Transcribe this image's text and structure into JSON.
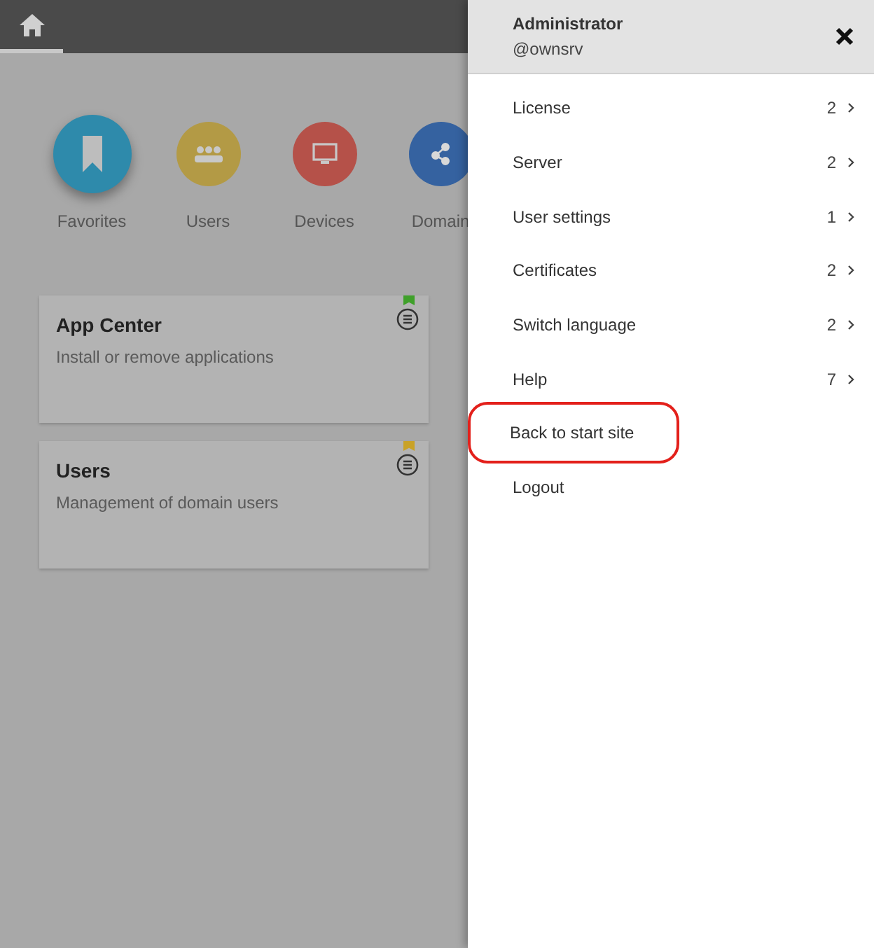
{
  "top_bar": {
    "home_tab": {
      "selected": true
    }
  },
  "categories": [
    {
      "label": "Favorites",
      "color": "#2e8aab",
      "kind": "bookmark",
      "selected": true
    },
    {
      "label": "Users",
      "color": "#b39a45",
      "kind": "users",
      "selected": false
    },
    {
      "label": "Devices",
      "color": "#b55149",
      "kind": "monitor",
      "selected": false
    },
    {
      "label": "Domain",
      "color": "#3562a0",
      "kind": "share",
      "selected": false
    }
  ],
  "cards": [
    {
      "title": "App Center",
      "description": "Install or remove applications",
      "color": "#3fa02a"
    },
    {
      "title": "Users",
      "description": "Management of domain users",
      "color": "#c9a227"
    }
  ],
  "drawer": {
    "user": "Administrator",
    "host": "@ownsrv",
    "items": [
      {
        "label": "License",
        "count": "2",
        "highlighted": false
      },
      {
        "label": "Server",
        "count": "2",
        "highlighted": false
      },
      {
        "label": "User settings",
        "count": "1",
        "highlighted": false
      },
      {
        "label": "Certificates",
        "count": "2",
        "highlighted": false
      },
      {
        "label": "Switch language",
        "count": "2",
        "highlighted": false
      },
      {
        "label": "Help",
        "count": "7",
        "highlighted": false
      },
      {
        "label": "Back to start site",
        "highlighted": true
      },
      {
        "label": "Logout",
        "highlighted": false
      }
    ]
  }
}
